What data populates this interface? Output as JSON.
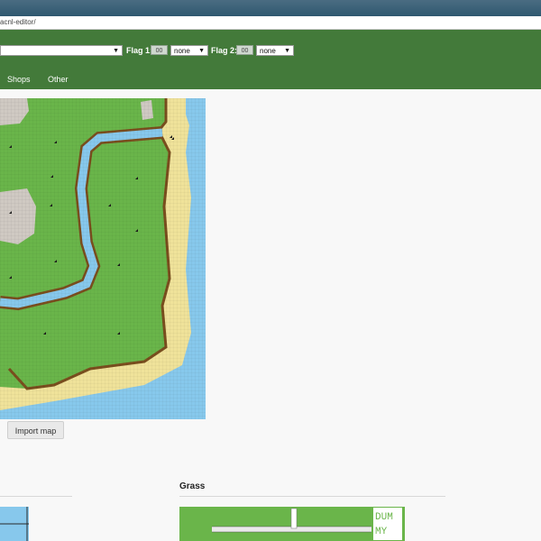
{
  "browser": {
    "url": "acnl-editor/"
  },
  "toolbar": {
    "flag1_label": "Flag 1:",
    "flag1_value": "00",
    "flag1_select": "none",
    "flag2_label": "Flag 2:",
    "flag2_value": "00",
    "flag2_select": "none"
  },
  "nav": {
    "items": [
      "Shops",
      "Other"
    ]
  },
  "map": {
    "import_button": "Import map"
  },
  "sections": {
    "grass_title": "Grass",
    "dummy_text_1": "DUM",
    "dummy_text_2": "MY"
  },
  "colors": {
    "header_green": "#437a3a",
    "grass": "#6ab54a",
    "water": "#87c8ec",
    "sand": "#efe29a",
    "rock": "#cfc9c2",
    "cliff": "#7a4e1e"
  }
}
